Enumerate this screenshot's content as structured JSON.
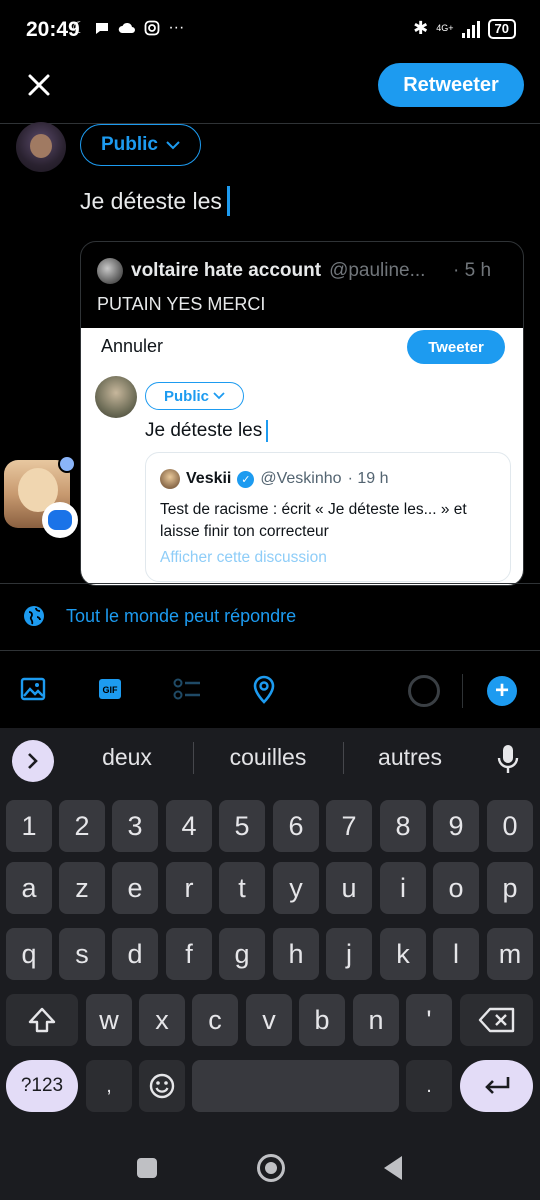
{
  "status_bar": {
    "time": "20:49",
    "network": "4G+",
    "battery": "70",
    "more": "···"
  },
  "header": {
    "close_icon": "close-icon",
    "retweet_label": "Retweeter"
  },
  "composer": {
    "audience_label": "Public",
    "text": "Je déteste les"
  },
  "quoted_tweet": {
    "display_name": "voltaire hate account",
    "handle": "@pauline...",
    "time": "· 5 h",
    "text": "PUTAIN YES MERCI",
    "image": {
      "cancel": "Annuler",
      "tweet_button": "Tweeter",
      "audience": "Public",
      "compose_text": "Je déteste les",
      "embedded": {
        "name": "Veskii",
        "handle": "@Veskinho",
        "time": "· 19 h",
        "text": "Test de racisme : écrit « Je déteste les... » et laisse finir ton correcteur",
        "link": "Afficher cette discussion"
      }
    }
  },
  "reply_setting": "Tout le monde peut répondre",
  "toolbar": {
    "gif_label": "GIF",
    "add_label": "+",
    "accent_color": "#1d9bf0"
  },
  "keyboard": {
    "suggestions": [
      "deux",
      "couilles",
      "autres"
    ],
    "row_numbers": [
      "1",
      "2",
      "3",
      "4",
      "5",
      "6",
      "7",
      "8",
      "9",
      "0"
    ],
    "row1": [
      "a",
      "z",
      "e",
      "r",
      "t",
      "y",
      "u",
      "i",
      "o",
      "p"
    ],
    "row2": [
      "q",
      "s",
      "d",
      "f",
      "g",
      "h",
      "j",
      "k",
      "l",
      "m"
    ],
    "row3": [
      "w",
      "x",
      "c",
      "v",
      "b",
      "n",
      "'"
    ],
    "symbols_label": "?123",
    "comma_label": ",",
    "period_label": "."
  }
}
